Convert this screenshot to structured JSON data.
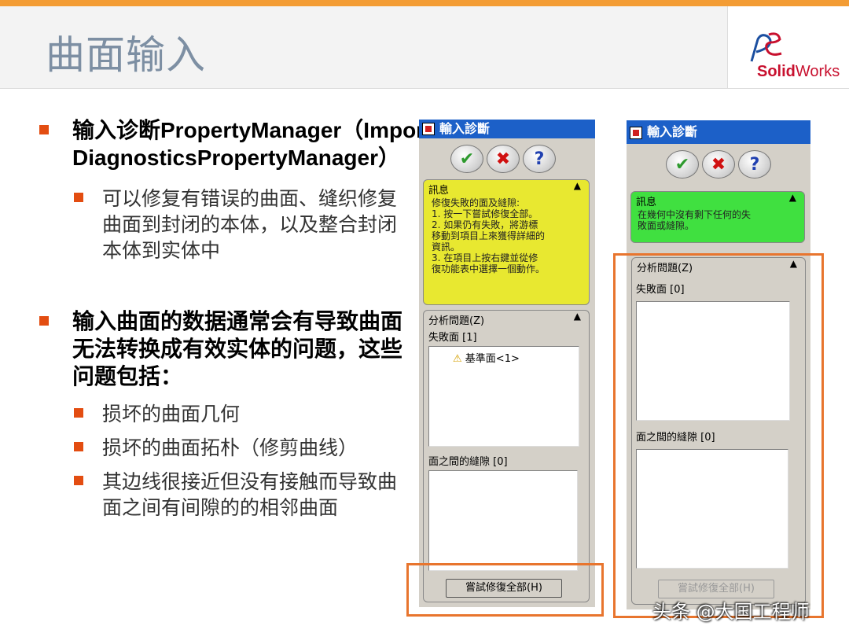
{
  "slide": {
    "title": "曲面输入",
    "logo": {
      "brand_top": "Solid",
      "brand_bottom": "Works"
    }
  },
  "bullets": [
    {
      "text": "输入诊断PropertyManager（Import DiagnosticsPropertyManager）",
      "sub": [
        "可以修复有错误的曲面、缝织修复曲面到封闭的本体，以及整合封闭本体到实体中"
      ]
    },
    {
      "text": "输入曲面的数据通常会有导致曲面无法转换成有效实体的问题，这些问题包括：",
      "sub": [
        "损坏的曲面几何",
        "损坏的曲面拓朴（修剪曲线）",
        "其边线很接近但没有接触而导致曲面之间有间隙的的相邻曲面"
      ]
    }
  ],
  "panel_left": {
    "title": "輸入診斷",
    "msg_header": "訊息",
    "msg_lines": [
      "修復失敗的面及縫隙:",
      "1. 按一下嘗試修復全部。",
      "2. 如果仍有失敗，將游標",
      "移動到項目上來獲得詳細的",
      "資訊。",
      "3. 在項目上按右鍵並從修",
      "復功能表中選擇一個動作。"
    ],
    "analyze_header": "分析問題(Z)",
    "faults_label": "失敗面 [1]",
    "fault_item": "基準面<1>",
    "gaps_label": "面之間的縫隙 [0]",
    "fix_button": "嘗試修復全部(H)",
    "msg_color": "#e8e830"
  },
  "panel_right": {
    "title": "輸入診斷",
    "msg_header": "訊息",
    "msg_lines": [
      "在幾何中沒有剩下任何的失",
      "敗面或縫隙。"
    ],
    "analyze_header": "分析問題(Z)",
    "faults_label": "失敗面 [0]",
    "gaps_label": "面之間的縫隙 [0]",
    "fix_button": "嘗試修復全部(H)",
    "msg_color": "#40e040"
  },
  "watermark": "头条 @大国工程师",
  "colors": {
    "accent": "#f39c34",
    "bullet": "#e34d11",
    "highlight": "#e8752e"
  }
}
